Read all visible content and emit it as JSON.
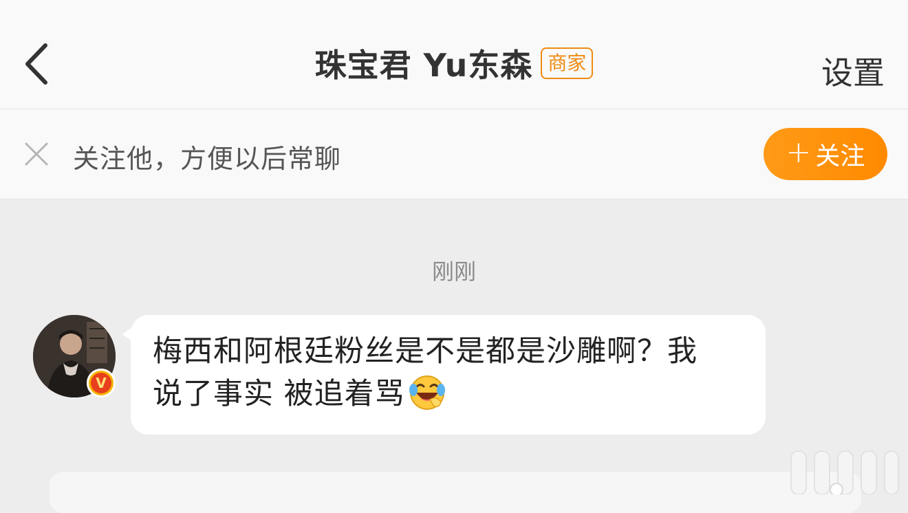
{
  "header": {
    "title": "珠宝君 Yu东森",
    "badge": "商家",
    "settings_label": "设置",
    "back_icon": "chevron-left-icon"
  },
  "follow_bar": {
    "close_icon": "close-icon",
    "text": "关注他，方便以后常聊",
    "button_plus": "+",
    "button_label": "关注"
  },
  "chat": {
    "timestamp": "刚刚",
    "messages": [
      {
        "line1": "梅西和阿根廷粉丝是不是都是沙雕啊？我",
        "line2": "说了事实 被追着骂",
        "emoji": "laughing-crying-emoji-icon",
        "verified": "V"
      }
    ]
  },
  "colors": {
    "accent": "#ff9100",
    "badge": "#ef8b13",
    "background": "#ededed",
    "bar": "#f9f9f9"
  }
}
